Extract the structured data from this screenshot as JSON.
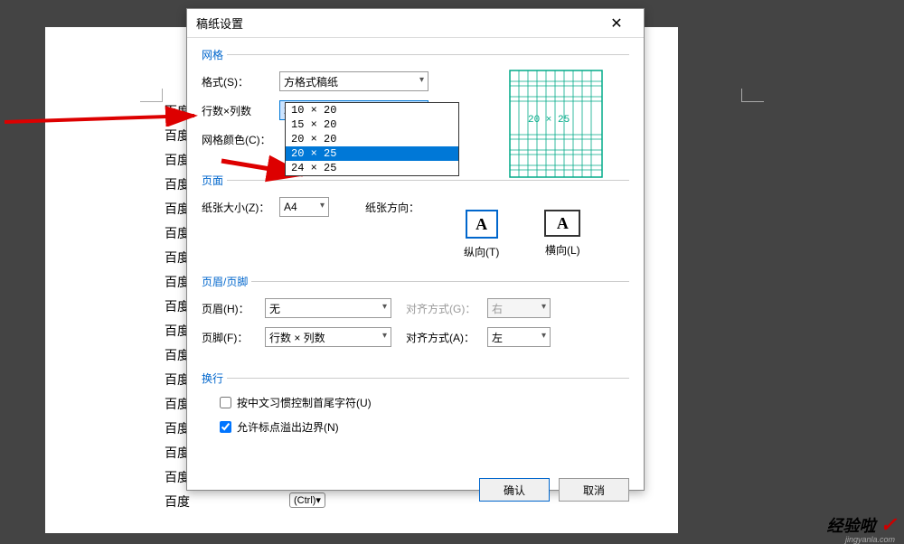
{
  "dialog": {
    "title": "稿纸设置",
    "close": "✕"
  },
  "grid_section": {
    "legend": "网格",
    "format_label": "格式(S)：",
    "format_value": "方格式稿纸",
    "rowcol_label": "行数×列数",
    "rowcol_value": "20 × 25",
    "color_label": "网格颜色(C)：",
    "dropdown": [
      "10 × 20",
      "15 × 20",
      "20 × 20",
      "20 × 25",
      "24 × 25"
    ],
    "preview_label": "20 × 25"
  },
  "page_section": {
    "legend": "页面",
    "size_label": "纸张大小(Z)：",
    "size_value": "A4",
    "orient_label": "纸张方向：",
    "portrait_label": "纵向(T)",
    "landscape_label": "横向(L)"
  },
  "header_section": {
    "legend": "页眉/页脚",
    "header_label": "页眉(H)：",
    "header_value": "无",
    "align_g_label": "对齐方式(G)：",
    "align_g_value": "右",
    "footer_label": "页脚(F)：",
    "footer_value": "行数 × 列数",
    "align_a_label": "对齐方式(A)：",
    "align_a_value": "左"
  },
  "wrap_section": {
    "legend": "换行",
    "chk1_label": "按中文习惯控制首尾字符(U)",
    "chk2_label": "允许标点溢出边界(N)"
  },
  "buttons": {
    "ok": "确认",
    "cancel": "取消"
  },
  "bg_lines": [
    "百度",
    "百度",
    "百度",
    "百度",
    "百度",
    "百度",
    "百度",
    "百度",
    "百度",
    "百度",
    "百度",
    "百度",
    "百度",
    "百度",
    "百度",
    "百度",
    "百度"
  ],
  "ctrl_tag": "(Ctrl)▾",
  "watermark": {
    "text": "经验啦",
    "sub": "jingyanla.com",
    "check": "✓"
  },
  "chart_data": null
}
